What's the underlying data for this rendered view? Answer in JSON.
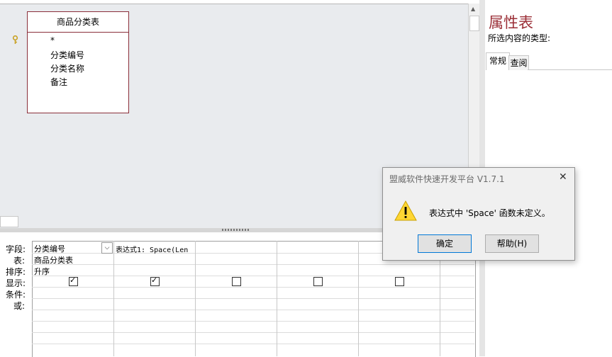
{
  "table_box": {
    "title": "商品分类表",
    "fields": [
      "*",
      "分类编号",
      "分类名称",
      "备注"
    ]
  },
  "properties": {
    "title": "属性表",
    "subtitle": "所选内容的类型:",
    "tabs": [
      "常规",
      "查阅"
    ]
  },
  "grid": {
    "row_labels": [
      "字段:",
      "表:",
      "排序:",
      "显示:",
      "条件:",
      "或:"
    ],
    "columns": [
      {
        "field": "分类编号",
        "table": "商品分类表",
        "sort": "升序",
        "show": true
      },
      {
        "field": "表达式1: Space(Len",
        "table": "",
        "sort": "",
        "show": true
      },
      {
        "field": "",
        "table": "",
        "sort": "",
        "show": false
      },
      {
        "field": "",
        "table": "",
        "sort": "",
        "show": false
      },
      {
        "field": "",
        "table": "",
        "sort": "",
        "show": false
      }
    ],
    "check_mark": "✓",
    "dropdown_glyph": "⌵"
  },
  "dialog": {
    "title": "盟威软件快速开发平台 V1.7.1",
    "close": "✕",
    "message": "表达式中 'Space' 函数未定义。",
    "ok": "确定",
    "help": "帮助(H)"
  },
  "scroll": {
    "up_arrow": "▲"
  },
  "colors": {
    "accent": "#9b2f37",
    "table_border": "#8b2f3a",
    "design_bg": "#e9ebee"
  }
}
